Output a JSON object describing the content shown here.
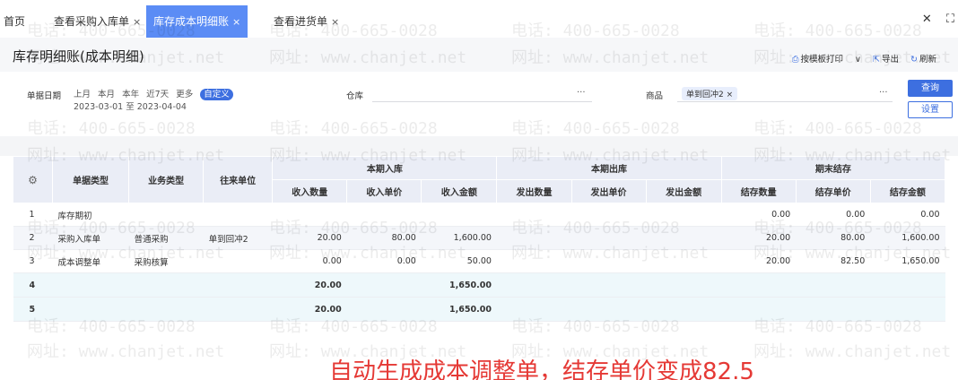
{
  "tabs": [
    {
      "label": "首页",
      "closable": false,
      "active": false
    },
    {
      "label": "查看采购入库单",
      "closable": true,
      "active": false
    },
    {
      "label": "库存成本明细账",
      "closable": true,
      "active": true
    },
    {
      "label": "查看进货单",
      "closable": true,
      "active": false
    }
  ],
  "close_glyph": "×",
  "tabbar_right": {
    "close": "✕",
    "expand": "⛶"
  },
  "page": {
    "title": "库存明细账(成本明细)"
  },
  "actions": {
    "print": "按模板打印",
    "print_caret": "∨",
    "export": "导出",
    "refresh": "刷新"
  },
  "filter": {
    "date_label": "单据日期",
    "quick_dates": [
      "上月",
      "本月",
      "本年",
      "近7天",
      "更多",
      "自定义"
    ],
    "selected_quick": "自定义",
    "date_range": "2023-03-01 至 2023-04-04",
    "warehouse_label": "仓库",
    "warehouse_value": "",
    "product_label": "商品",
    "product_tag": "单到回冲2",
    "tag_close": "×",
    "more_dots": "···",
    "query_button": "查询",
    "settings_button": "设置"
  },
  "table": {
    "group_headers": [
      "本期入库",
      "本期出库",
      "期末结存"
    ],
    "fixed_headers": [
      "单据类型",
      "业务类型",
      "往来单位"
    ],
    "sub_headers": [
      "收入数量",
      "收入单价",
      "收入金额",
      "发出数量",
      "发出单价",
      "发出金额",
      "结存数量",
      "结存单价",
      "结存金额"
    ],
    "rows": [
      {
        "no": "1",
        "doc_type": "库存期初",
        "biz_type": "",
        "partner": "",
        "in_qty": "",
        "in_price": "",
        "in_amt": "",
        "out_qty": "",
        "out_price": "",
        "out_amt": "",
        "bal_qty": "0.00",
        "bal_price": "0.00",
        "bal_amt": "0.00"
      },
      {
        "no": "2",
        "doc_type": "采购入库单",
        "biz_type": "普通采购",
        "partner": "单到回冲2",
        "in_qty": "20.00",
        "in_price": "80.00",
        "in_amt": "1,600.00",
        "out_qty": "",
        "out_price": "",
        "out_amt": "",
        "bal_qty": "20.00",
        "bal_price": "80.00",
        "bal_amt": "1,600.00"
      },
      {
        "no": "3",
        "doc_type": "成本调整单",
        "biz_type": "采购核算",
        "partner": "",
        "in_qty": "0.00",
        "in_price": "0.00",
        "in_amt": "50.00",
        "out_qty": "",
        "out_price": "",
        "out_amt": "",
        "bal_qty": "20.00",
        "bal_price": "82.50",
        "bal_amt": "1,650.00"
      }
    ],
    "totals": [
      {
        "no": "4",
        "in_qty": "20.00",
        "in_amt": "1,650.00"
      },
      {
        "no": "5",
        "in_qty": "20.00",
        "in_amt": "1,650.00"
      }
    ]
  },
  "watermark": {
    "phone": "电话: 400-665-0028",
    "site": "网址: www.chanjet.net"
  },
  "annotation": "自动生成成本调整单，结存单价变成82.5",
  "colors": {
    "accent": "#3d6fe0",
    "active_tab": "#5b8cf5",
    "annotation": "#e53935"
  }
}
